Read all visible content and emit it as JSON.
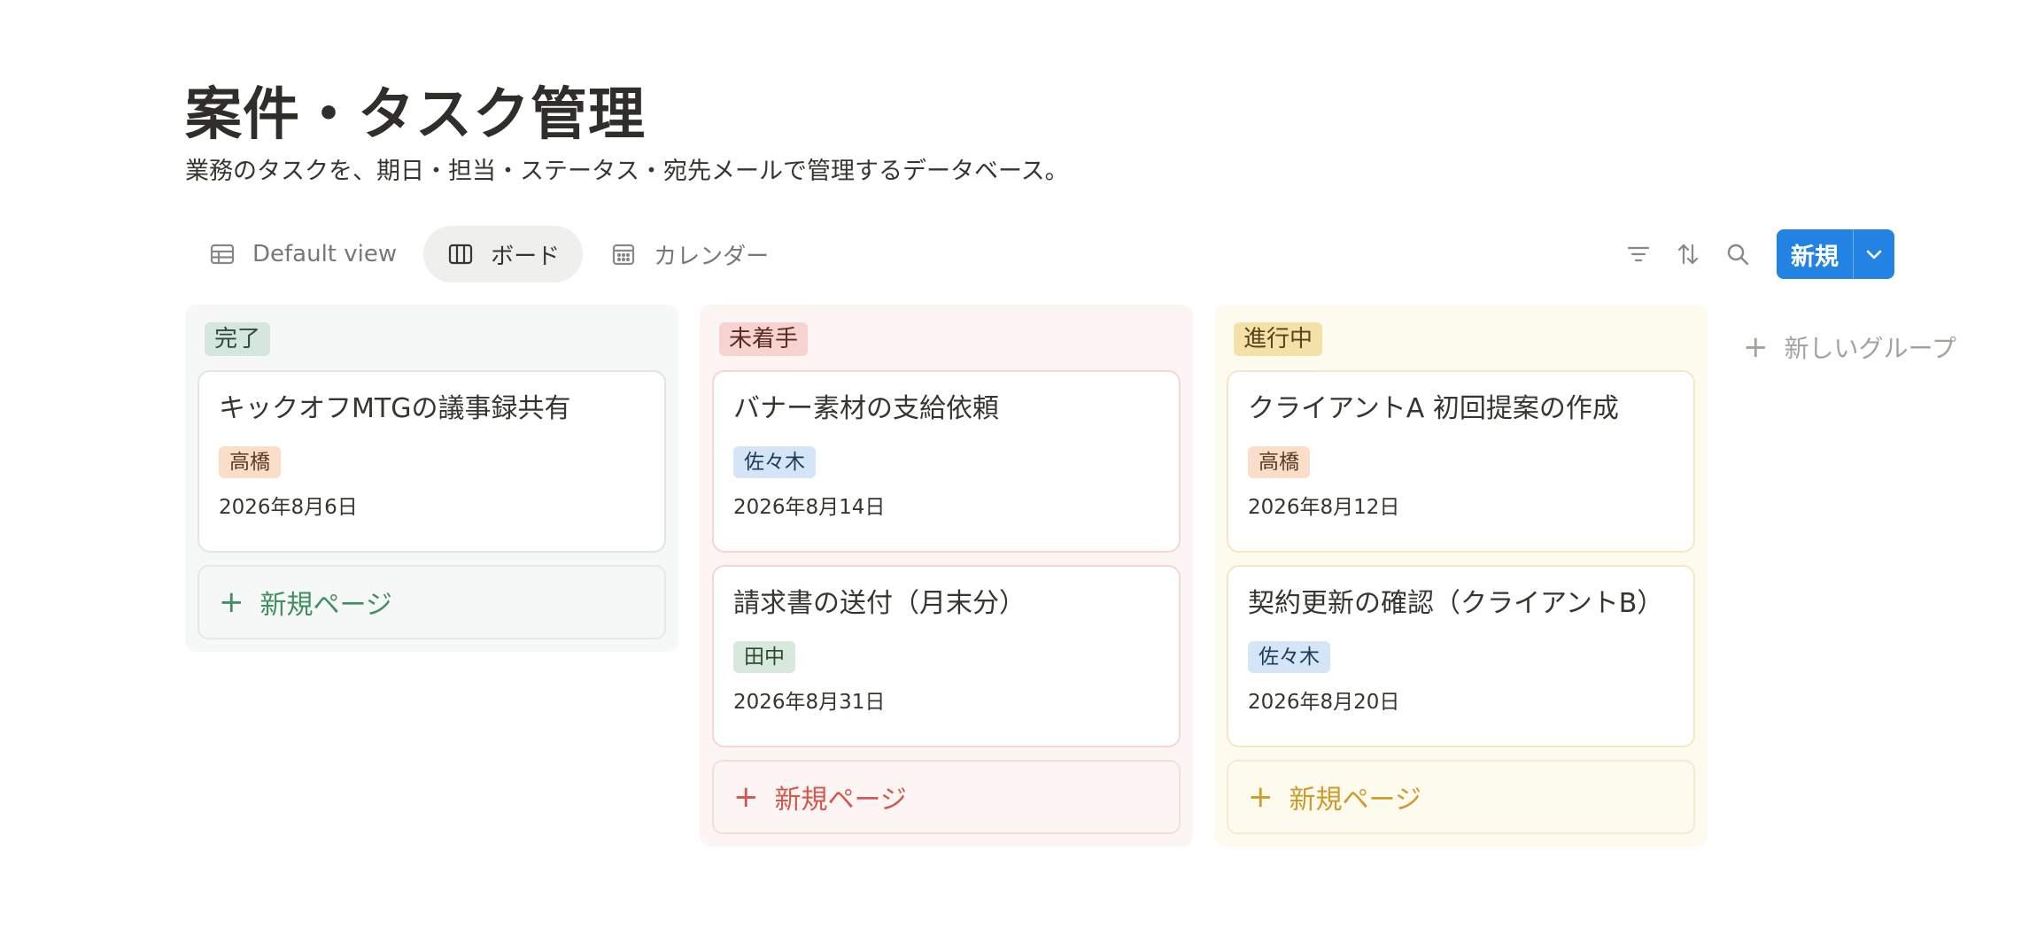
{
  "page": {
    "title": "案件・タスク管理",
    "description": "業務のタスクを、期日・担当・ステータス・宛先メールで管理するデータベース。"
  },
  "views": [
    {
      "label": "Default view",
      "icon": "table-icon",
      "active": false
    },
    {
      "label": "ボード",
      "icon": "board-icon",
      "active": true
    },
    {
      "label": "カレンダー",
      "icon": "calendar-icon",
      "active": false
    }
  ],
  "toolbar": {
    "filter_icon": "filter-icon",
    "sort_icon": "sort-icon",
    "search_icon": "search-icon",
    "new_label": "新規",
    "new_dropdown_icon": "chevron-down-icon",
    "accent": "#2383e2"
  },
  "columns": [
    {
      "label": "完了",
      "color": "#d4e6dd",
      "cards": [
        {
          "title": "キックオフMTGの議事録共有",
          "assignee": "高橋",
          "date": "2026年8月6日"
        }
      ],
      "add_label": "新規ページ"
    },
    {
      "label": "未着手",
      "color": "#f7d3d0",
      "cards": [
        {
          "title": "バナー素材の支給依頼",
          "assignee": "佐々木",
          "date": "2026年8月14日"
        },
        {
          "title": "請求書の送付（月末分）",
          "assignee": "田中",
          "date": "2026年8月31日"
        }
      ],
      "add_label": "新規ページ"
    },
    {
      "label": "進行中",
      "color": "#f4e1a8",
      "cards": [
        {
          "title": "クライアントA 初回提案の作成",
          "assignee": "高橋",
          "date": "2026年8月12日"
        },
        {
          "title": "契約更新の確認（クライアントB）",
          "assignee": "佐々木",
          "date": "2026年8月20日"
        }
      ],
      "add_label": "新規ページ"
    }
  ],
  "new_group_label": "新しいグループ"
}
